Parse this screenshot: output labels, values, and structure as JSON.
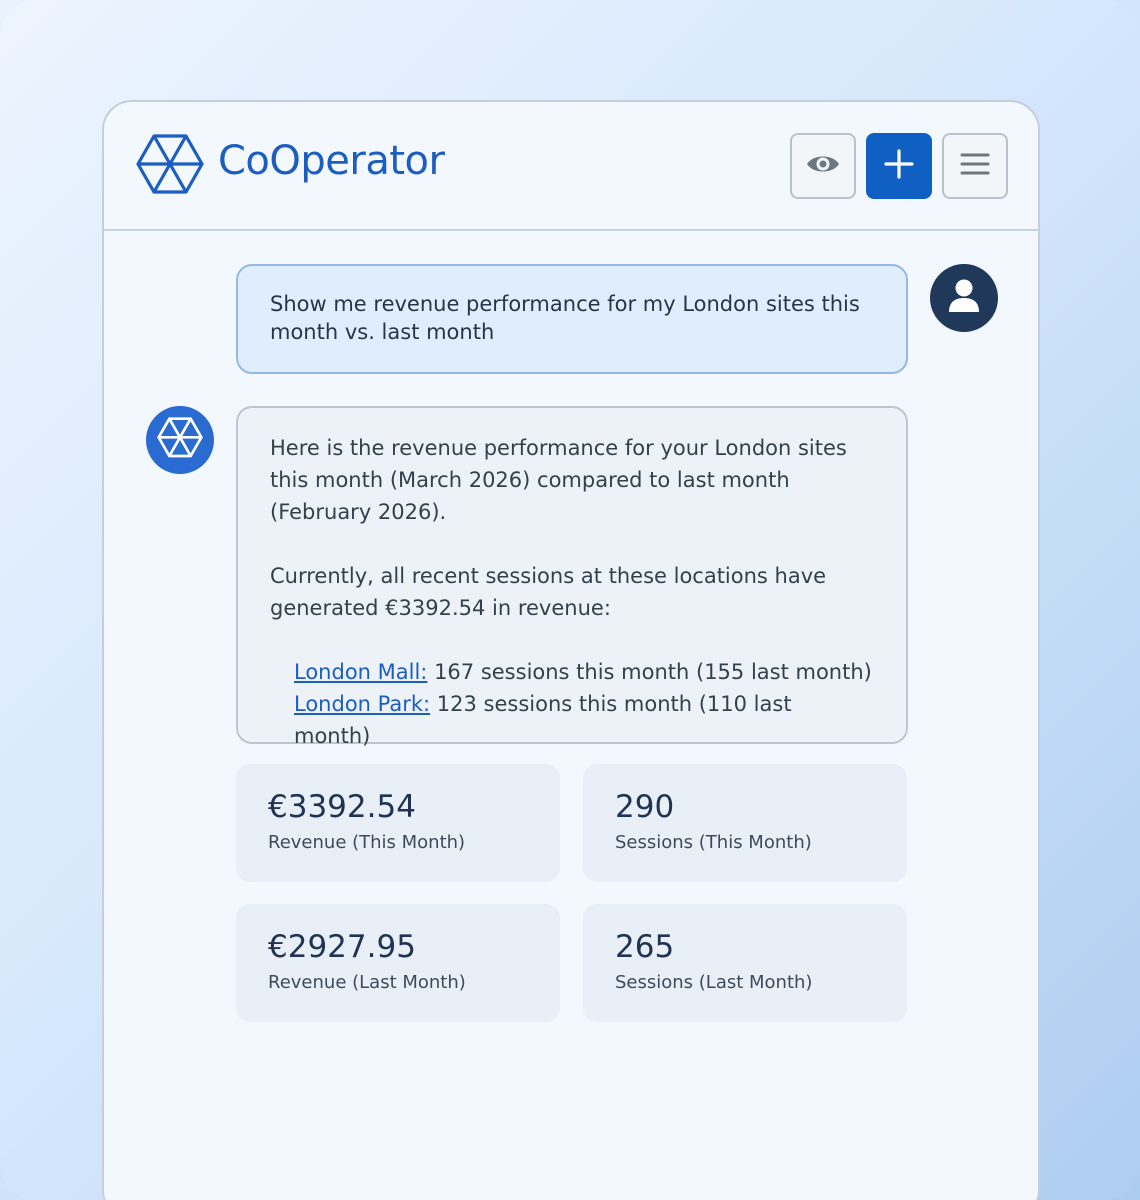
{
  "app": {
    "brand": "CoOperator",
    "accent_color": "#1c5dc0",
    "icons": [
      "logo-icon",
      "eye-icon",
      "plus-icon",
      "menu-icon",
      "user-icon",
      "bot-icon"
    ]
  },
  "conversation": {
    "user_message": "Show me revenue performance for my London sites this month vs. last month",
    "bot_paragraph_1": "Here is the revenue performance for your London sites this month (March 2026) compared to last month (February 2026).",
    "bot_paragraph_2": "Currently, all recent sessions at these locations have generated €3392.54 in revenue:",
    "sites": [
      {
        "name": "London Mall:",
        "detail": " 167 sessions this month (155 last month)"
      },
      {
        "name": "London Park:",
        "detail": " 123 sessions this month (110 last month)"
      }
    ]
  },
  "stats": [
    {
      "value": "€3392.54",
      "label": "Revenue (This Month)"
    },
    {
      "value": "290",
      "label": "Sessions (This Month)"
    },
    {
      "value": "€2927.95",
      "label": "Revenue (Last Month)"
    },
    {
      "value": "265",
      "label": "Sessions (Last Month)"
    }
  ]
}
